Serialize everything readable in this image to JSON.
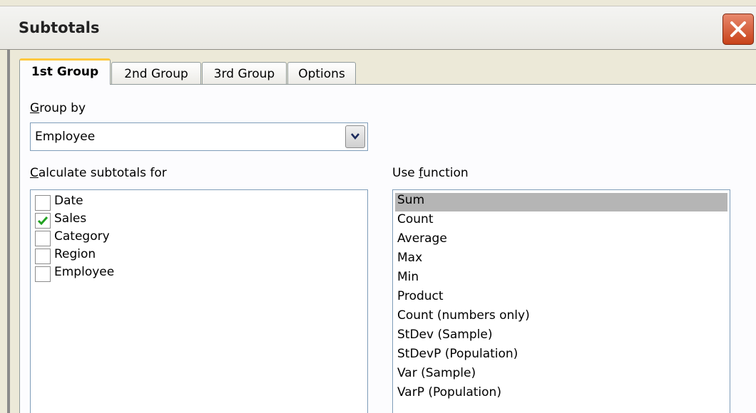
{
  "window": {
    "title": "Subtotals"
  },
  "tabs": [
    {
      "label": "1st Group",
      "active": true
    },
    {
      "label": "2nd Group",
      "active": false
    },
    {
      "label": "3rd Group",
      "active": false
    },
    {
      "label": "Options",
      "active": false
    }
  ],
  "group_by": {
    "label_access": "G",
    "label_rest": "roup by",
    "selected": "Employee"
  },
  "calculate": {
    "label_access": "C",
    "label_rest": "alculate subtotals for",
    "items": [
      {
        "label": "Date",
        "checked": false
      },
      {
        "label": "Sales",
        "checked": true
      },
      {
        "label": "Category",
        "checked": false
      },
      {
        "label": "Region",
        "checked": false
      },
      {
        "label": "Employee",
        "checked": false
      }
    ]
  },
  "use_function": {
    "label_pre": "Use ",
    "label_access": "f",
    "label_rest": "unction",
    "selected": "Sum",
    "items": [
      "Sum",
      "Count",
      "Average",
      "Max",
      "Min",
      "Product",
      "Count (numbers only)",
      "StDev (Sample)",
      "StDevP (Population)",
      "Var (Sample)",
      "VarP (Population)"
    ]
  },
  "colors": {
    "check": "#21a121",
    "selected_bg": "#b5b5b5",
    "active_tab_accent": "#ffc83c"
  }
}
